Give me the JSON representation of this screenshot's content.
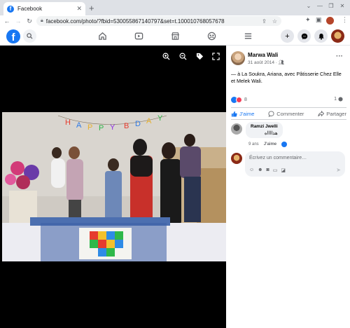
{
  "browser": {
    "tab_title": "Facebook",
    "url": "facebook.com/photo/?fbid=530055867140797&set=t.100010768057678"
  },
  "colors": {
    "facebook_blue": "#1877f2",
    "viewer_bg": "#000000",
    "chrome_frame": "#dee1e6"
  },
  "post": {
    "author": "Marwa Wali",
    "date": "31 août 2014",
    "text": "— à La Soukra, Ariana, avec Pâtisserie Chez Elle et Melek Wali.",
    "reaction_count": "8",
    "comment_count": "1"
  },
  "actions": {
    "like": "J'aime",
    "comment": "Commenter",
    "share": "Partager"
  },
  "comment": {
    "author": "Ramzi Jwelli",
    "text": "هذااااه",
    "time": "9 ans",
    "like": "J'aime"
  },
  "composer": {
    "placeholder": "Écrivez un commentaire…"
  },
  "icons": {
    "viewer_tools": [
      "zoom-in-icon",
      "zoom-out-icon",
      "tag-icon",
      "fullscreen-icon"
    ],
    "composer_tools": [
      "avatar-sticker-icon",
      "emoji-icon",
      "camera-icon",
      "gif-icon",
      "sticker-icon"
    ]
  }
}
